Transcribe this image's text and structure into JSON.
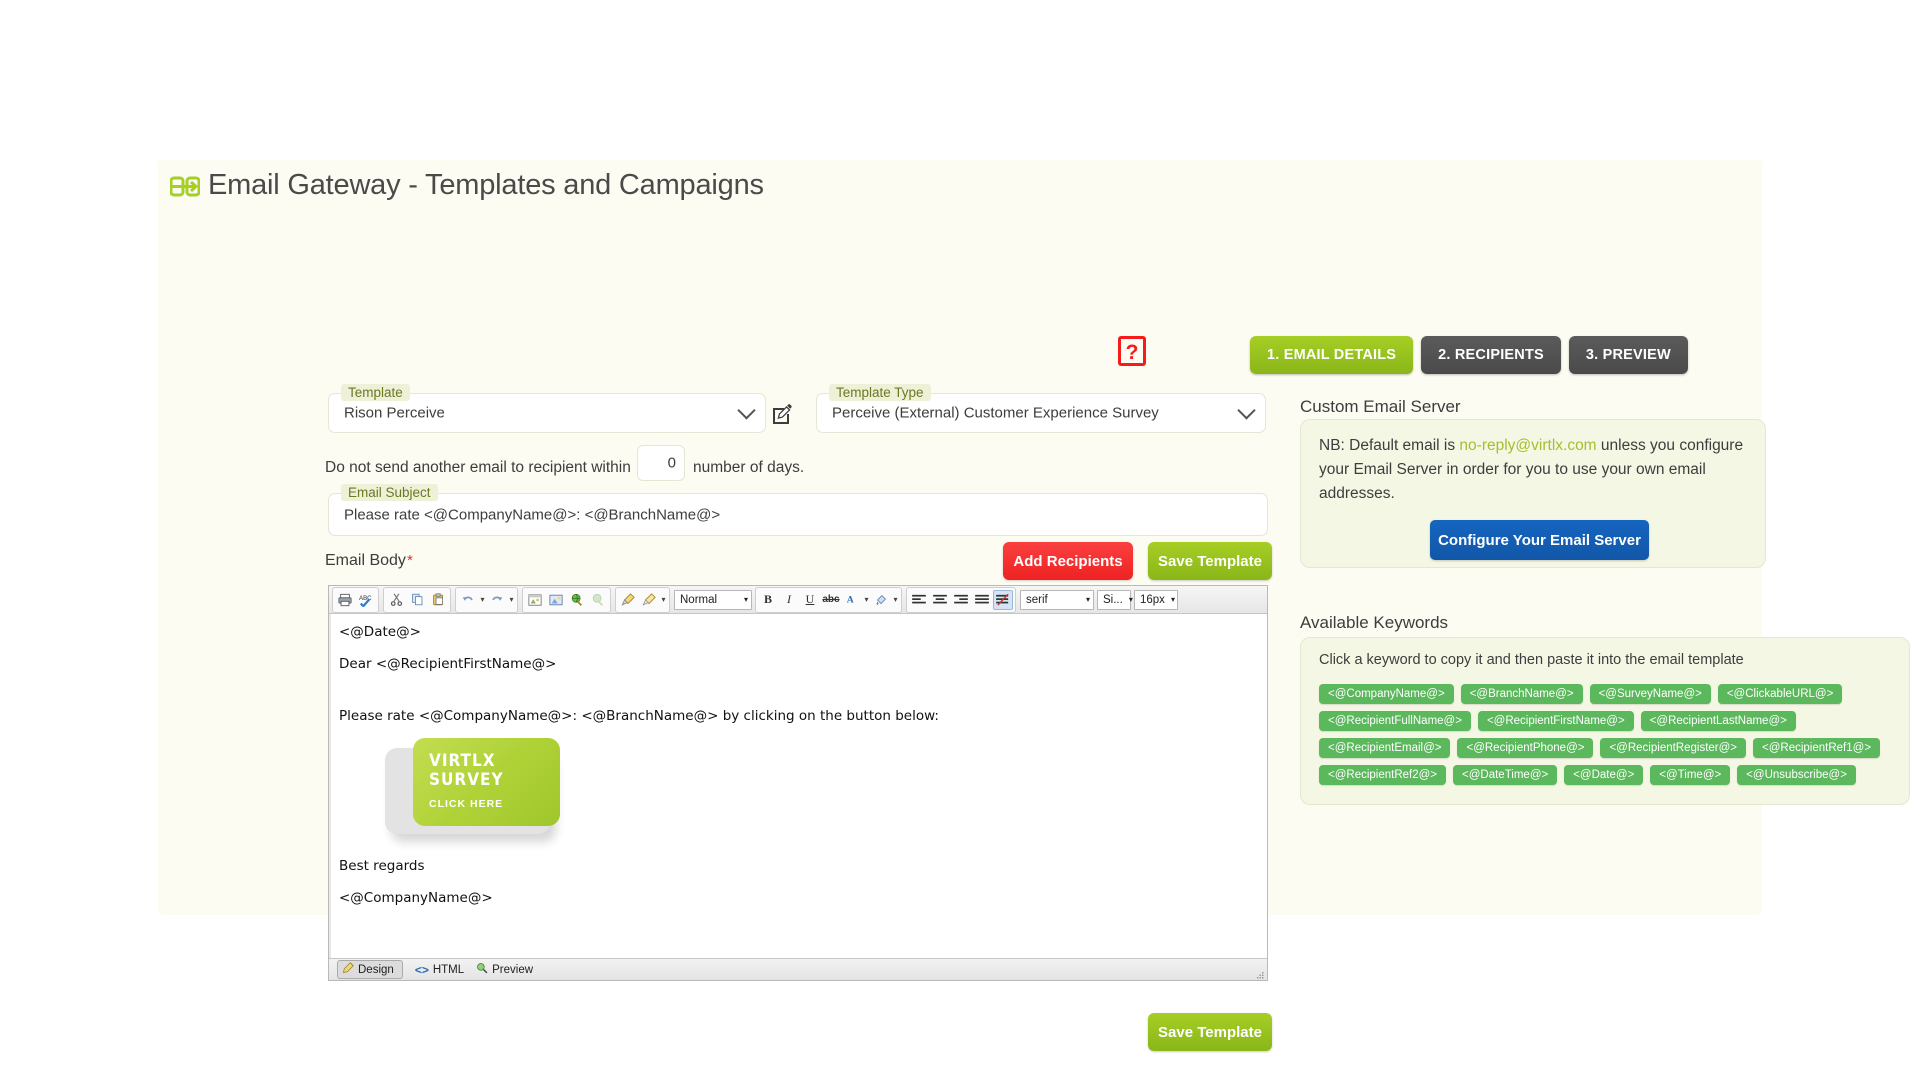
{
  "header": {
    "title": "Email Gateway - Templates and Campaigns",
    "logo_icon": "email-gateway-icon",
    "help_icon_label": "?",
    "tabs": [
      {
        "label": "1. EMAIL DETAILS",
        "state": "active"
      },
      {
        "label": "2. RECIPIENTS",
        "state": "inactive"
      },
      {
        "label": "3. PREVIEW",
        "state": "inactive"
      }
    ]
  },
  "form": {
    "template": {
      "label": "Template",
      "value": "Rison Perceive"
    },
    "template_type": {
      "label": "Template Type",
      "value": "Perceive (External) Customer Experience Survey"
    },
    "throttle": {
      "prefix": "Do not send another email to recipient within",
      "value": "0",
      "suffix": "number of days."
    },
    "email_subject": {
      "label": "Email Subject",
      "value": "Please rate <@CompanyName@>: <@BranchName@>"
    },
    "email_body_label": "Email Body",
    "required_mark": "*"
  },
  "actions": {
    "add_recipients": "Add Recipients",
    "save_template_top": "Save Template",
    "save_template_bottom": "Save Template"
  },
  "editor": {
    "toolbar": {
      "groups": [
        {
          "icons": [
            "print-icon",
            "spellcheck-icon"
          ]
        },
        {
          "icons": [
            "cut-icon",
            "copy-icon",
            "paste-icon"
          ]
        },
        {
          "icons": [
            "undo-icon",
            "redo-icon"
          ],
          "carets": true
        },
        {
          "icons": [
            "insert-image-icon",
            "image-properties-icon",
            "insert-link-icon",
            "remove-link-icon"
          ]
        },
        {
          "icons": [
            "format-painter-icon",
            "clear-format-brush-icon"
          ],
          "carets": true
        }
      ],
      "paragraph_style": "Normal",
      "text_buttons": [
        "B",
        "I",
        "U",
        "abc"
      ],
      "font_color_icon": "font-color-icon",
      "highlight_icon": "highlight-color-icon",
      "align_icons": [
        "align-left-icon",
        "align-center-icon",
        "align-right-icon",
        "align-justify-icon",
        "remove-format-icon"
      ],
      "font_family": "serif",
      "font_size_label": "Si...",
      "font_size": "16px"
    },
    "body_lines": [
      "<@Date@>",
      "",
      "Dear <@RecipientFirstName@>",
      "",
      "",
      "Please rate <@CompanyName@>: <@BranchName@> by clicking on the button below:"
    ],
    "survey_button": {
      "line1": "VIRTLX",
      "line2": "SURVEY",
      "line3": "CLICK HERE"
    },
    "closing_lines": [
      "Best regards",
      "",
      "<@CompanyName@>"
    ],
    "tabs": [
      {
        "label": "Design",
        "icon": "pencil-icon",
        "selected": true
      },
      {
        "label": "HTML",
        "icon": "code-icon",
        "selected": false
      },
      {
        "label": "Preview",
        "icon": "magnifier-icon",
        "selected": false
      }
    ]
  },
  "custom_email_server": {
    "title": "Custom Email Server",
    "note_prefix": "NB: Default email is ",
    "note_email": "no-reply@virtlx.com",
    "note_suffix": " unless you configure your Email Server in order for you to use your own email addresses.",
    "button": "Configure Your Email Server"
  },
  "available_keywords": {
    "title": "Available Keywords",
    "hint": "Click a keyword to copy it and then paste it into the email template",
    "items": [
      "<@CompanyName@>",
      "<@BranchName@>",
      "<@SurveyName@>",
      "<@ClickableURL@>",
      "<@RecipientFullName@>",
      "<@RecipientFirstName@>",
      "<@RecipientLastName@>",
      "<@RecipientEmail@>",
      "<@RecipientPhone@>",
      "<@RecipientRegister@>",
      "<@RecipientRef1@>",
      "<@RecipientRef2@>",
      "<@DateTime@>",
      "<@Date@>",
      "<@Time@>",
      "<@Unsubscribe@>"
    ]
  },
  "colors": {
    "accent_green": "#a6ce25",
    "danger_red": "#ef2222",
    "link_blue": "#1565c0",
    "keyword_green": "#5cb85c",
    "panel_bg": "#f4f7e4",
    "page_bg": "#fcfcf2"
  }
}
